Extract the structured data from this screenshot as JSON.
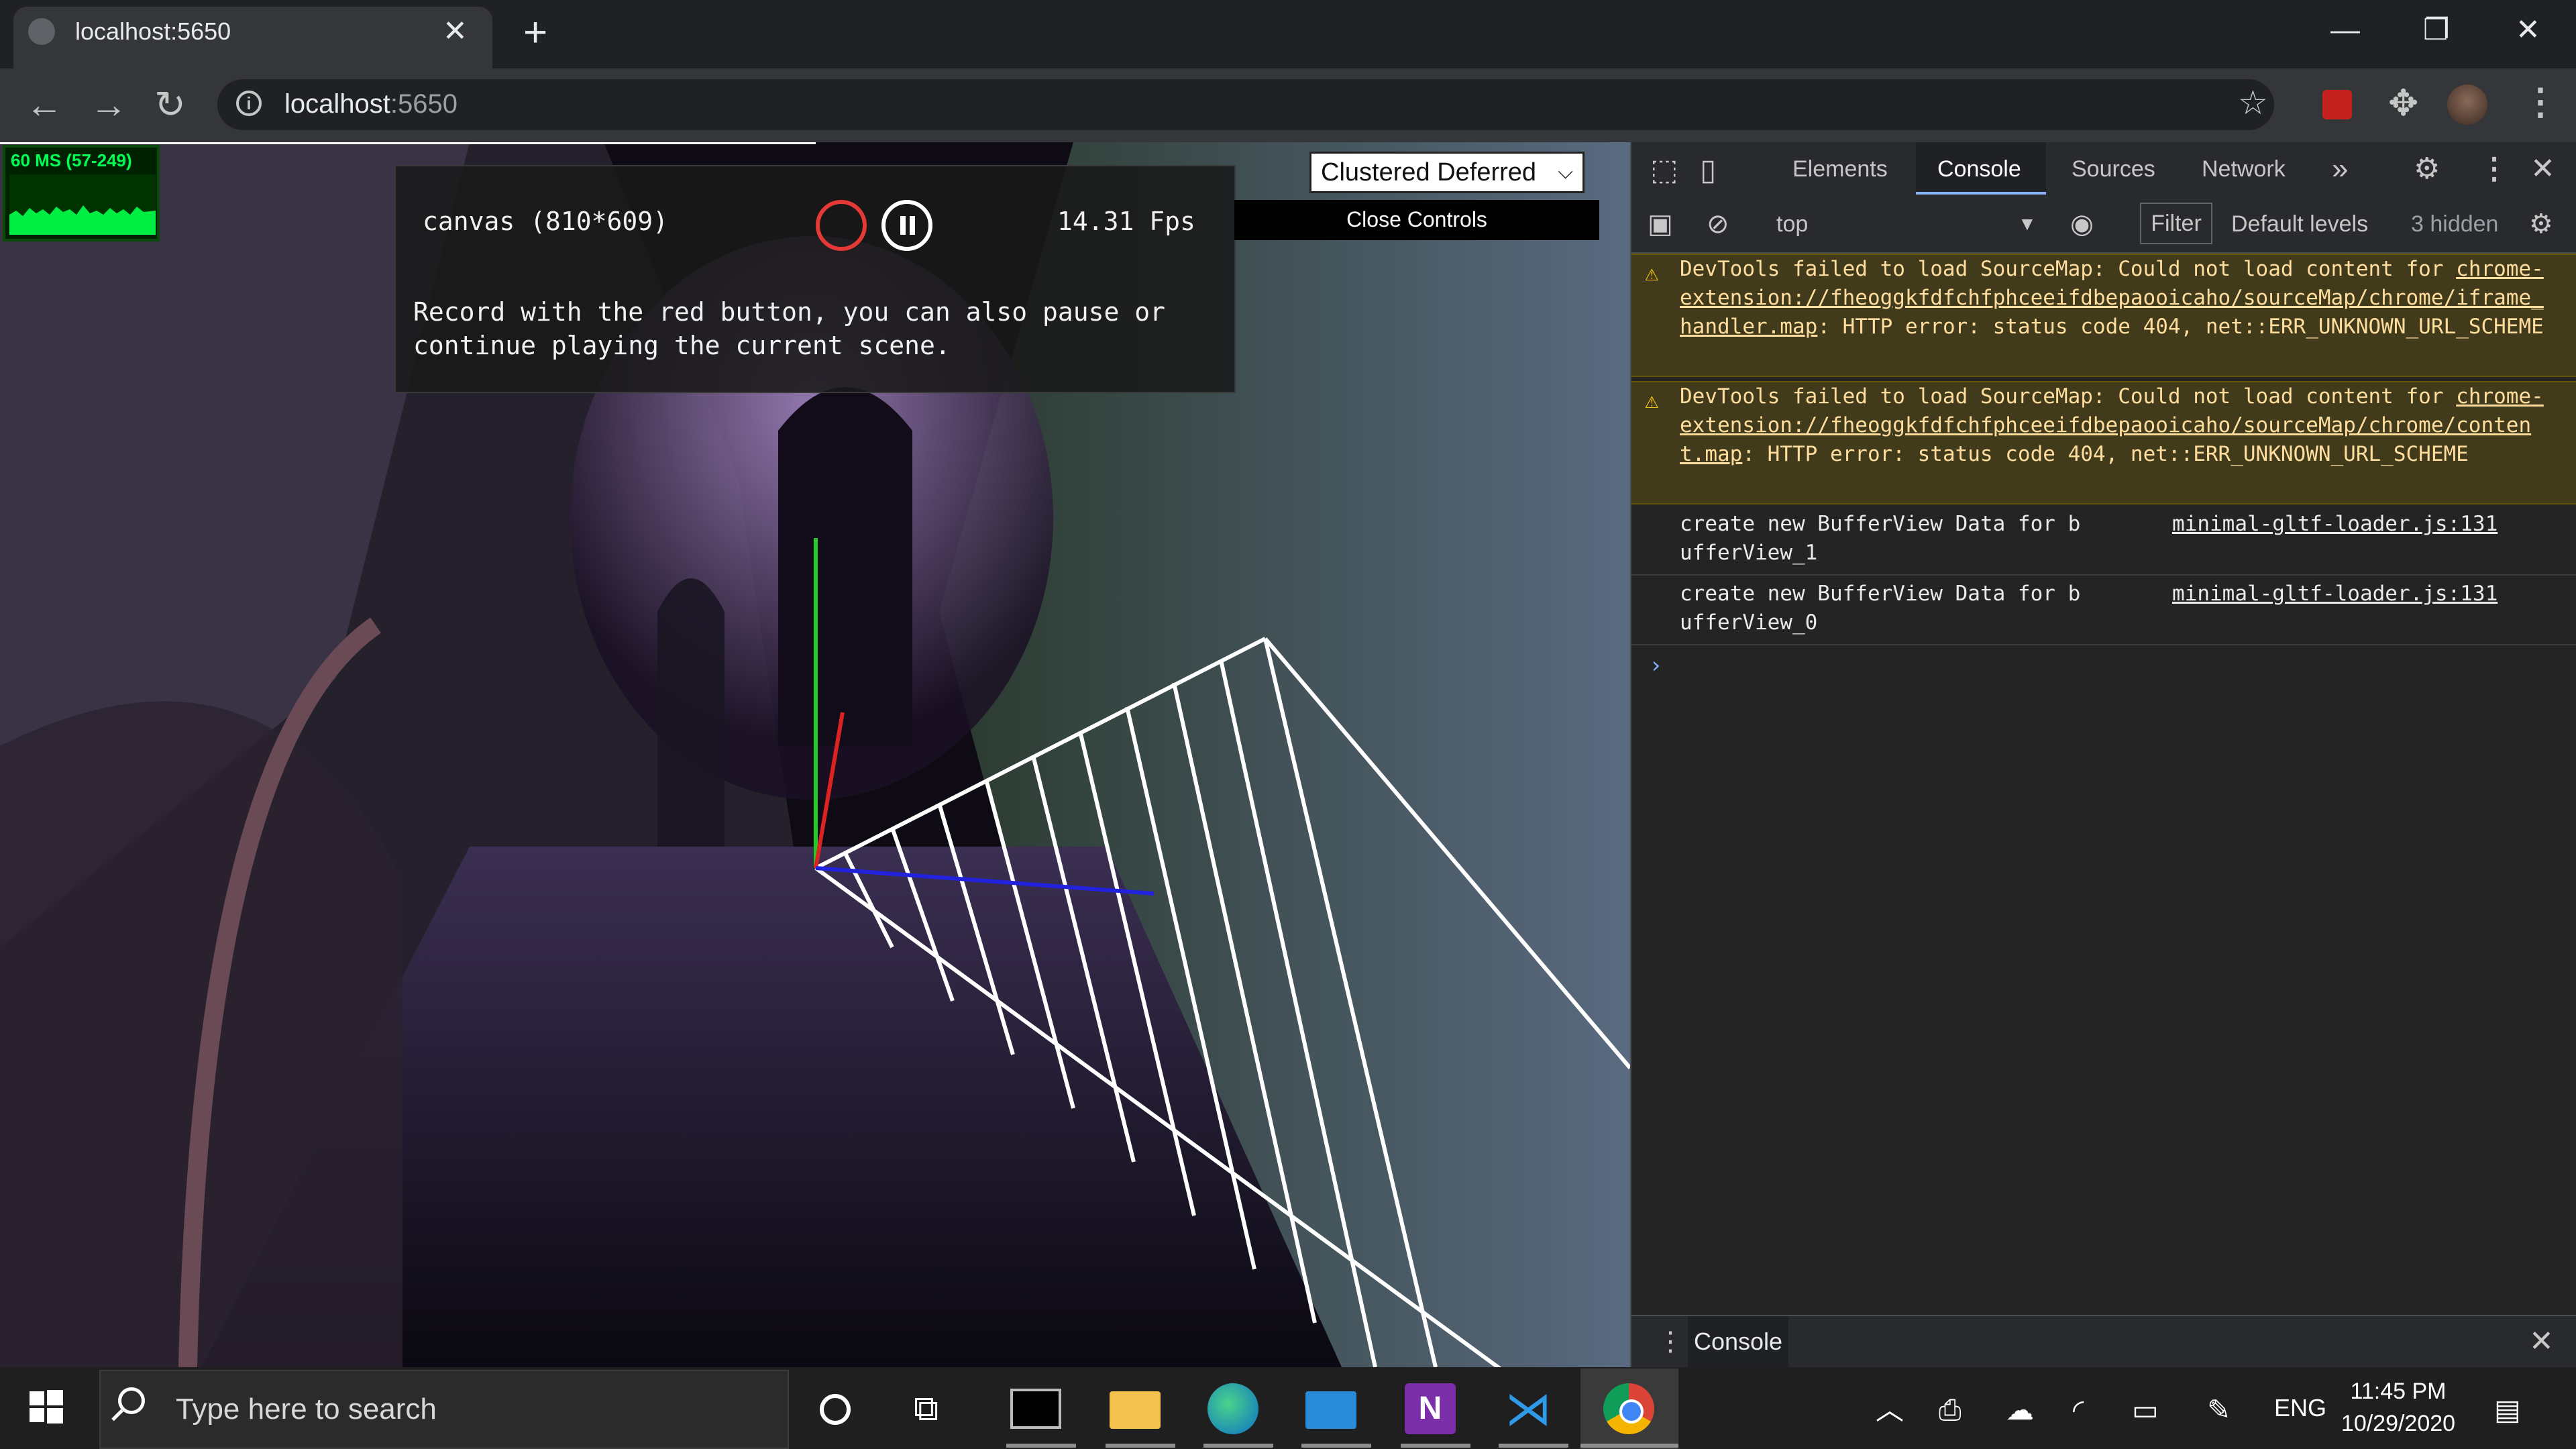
{
  "browser": {
    "tab_title": "localhost:5650",
    "url_host": "localhost",
    "url_port": ":5650"
  },
  "viewport": {
    "stats_text": "60 MS (57-249)",
    "recorder": {
      "canvas_label": "canvas (810*609)",
      "fps": "14.31 Fps",
      "help": "Record with the red button, you can also pause or continue playing the current scene."
    },
    "renderer_select": "Clustered Deferred",
    "close_controls": "Close Controls"
  },
  "devtools": {
    "tabs": [
      "Elements",
      "Console",
      "Sources",
      "Network"
    ],
    "active_tab": "Console",
    "overflow": "»",
    "context": "top",
    "filter_label": "Filter",
    "levels": "Default levels",
    "hidden": "3 hidden",
    "messages": [
      {
        "type": "warning",
        "prefix": "DevTools failed to load SourceMap: Could not load content for ",
        "link": "chrome-extension://fheoggkfdfchfphceeifdbepaooicaho/sourceMap/chrome/iframe_handler.map",
        "suffix": ": HTTP error: status code 404, net::ERR_UNKNOWN_URL_SCHEME"
      },
      {
        "type": "warning",
        "prefix": "DevTools failed to load SourceMap: Could not load content for ",
        "link": "chrome-extension://fheoggkfdfchfphceeifdbepaooicaho/sourceMap/chrome/content.map",
        "suffix": ": HTTP error: status code 404, net::ERR_UNKNOWN_URL_SCHEME"
      },
      {
        "type": "log",
        "text": "create new BufferView Data for bufferView_1",
        "source": "minimal-gltf-loader.js:131"
      },
      {
        "type": "log",
        "text": "create new BufferView Data for bufferView_0",
        "source": "minimal-gltf-loader.js:131"
      }
    ],
    "prompt": "›",
    "drawer_tab": "Console"
  },
  "taskbar": {
    "search_placeholder": "Type here to search",
    "language": "ENG",
    "time": "11:45 PM",
    "date": "10/29/2020"
  },
  "colors": {
    "record": "#e53935",
    "accent": "#8ab4f8",
    "warning_bg": "#413b1b"
  }
}
